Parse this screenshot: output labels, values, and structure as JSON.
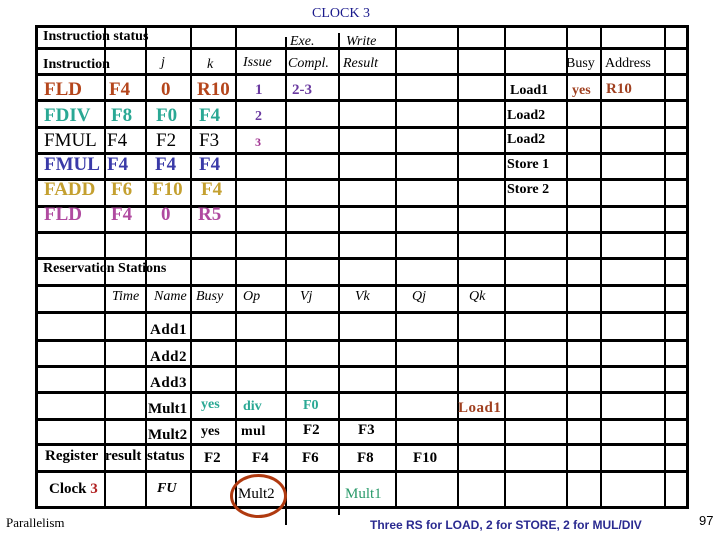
{
  "title": "CLOCK 3",
  "colors": {
    "title": "#1a1a8c",
    "fld1": "#b5461c",
    "fdiv": "#2aa894",
    "fmul1": "#000000",
    "fmul2": "#3a3aa8",
    "fadd": "#c4a030",
    "fld2": "#b04aa0",
    "issue": "#6a3aa0",
    "issue3": "#a03090",
    "load1": "#a04020",
    "mult1": "#2a9a6a",
    "clock_num": "#b02020",
    "highlight_circle": "#b03a10",
    "footer_note": "#2a2a90"
  },
  "instruction_status": {
    "section_label": "Instruction status",
    "headers": {
      "instruction": "Instruction",
      "j": "j",
      "k": "k",
      "issue": "Issue",
      "exe_top": "Exe.",
      "exe_bottom": "Compl.",
      "write_top": "Write",
      "write_bottom": "Result"
    },
    "rows": [
      {
        "op": "FLD",
        "dest": "F4",
        "j": "0",
        "k": "R10",
        "issue": "1",
        "exec": "2-3",
        "write": ""
      },
      {
        "op": "FDIV",
        "dest": "F8",
        "j": "F0",
        "k": "F4",
        "issue": "2",
        "exec": "",
        "write": ""
      },
      {
        "op": "FMUL",
        "dest": "F4",
        "j": "F2",
        "k": "F3",
        "issue": "3",
        "exec": "",
        "write": ""
      },
      {
        "op": "FMUL",
        "dest": "F4",
        "j": "F4",
        "k": "F4",
        "issue": "",
        "exec": "",
        "write": ""
      },
      {
        "op": "FADD",
        "dest": "F6",
        "j": "F10",
        "k": "F4",
        "issue": "",
        "exec": "",
        "write": ""
      },
      {
        "op": "FLD",
        "dest": "F4",
        "j": "0",
        "k": "R5",
        "issue": "",
        "exec": "",
        "write": ""
      }
    ]
  },
  "load_store_buffers": {
    "headers": {
      "busy": "Busy",
      "address": "Address"
    },
    "rows": [
      {
        "name": "Load1",
        "busy": "yes",
        "address": "R10"
      },
      {
        "name": "Load2",
        "busy": "",
        "address": ""
      },
      {
        "name": "Load2",
        "busy": "",
        "address": ""
      },
      {
        "name": "Store 1",
        "busy": "",
        "address": ""
      },
      {
        "name": "Store 2",
        "busy": "",
        "address": ""
      }
    ]
  },
  "reservation_stations": {
    "section_label": "Reservation Stations",
    "headers": {
      "time": "Time",
      "name": "Name",
      "busy": "Busy",
      "op": "Op",
      "vj": "Vj",
      "vk": "Vk",
      "qj": "Qj",
      "qk": "Qk"
    },
    "rows": [
      {
        "name": "Add1",
        "busy": "",
        "op": "",
        "vj": "",
        "vk": "",
        "qj": "",
        "qk": ""
      },
      {
        "name": "Add2",
        "busy": "",
        "op": "",
        "vj": "",
        "vk": "",
        "qj": "",
        "qk": ""
      },
      {
        "name": "Add3",
        "busy": "",
        "op": "",
        "vj": "",
        "vk": "",
        "qj": "",
        "qk": ""
      },
      {
        "name": "Mult1",
        "busy": "yes",
        "op": "div",
        "vj": "F0",
        "vk": "",
        "qj": "",
        "qk": "Load1"
      },
      {
        "name": "Mult2",
        "busy": "yes",
        "op": "mul",
        "vj": "F2",
        "vk": "F3",
        "qj": "",
        "qk": ""
      }
    ]
  },
  "register_result_status": {
    "label_parts": [
      "Register",
      "result",
      "status"
    ],
    "registers": [
      "F2",
      "F4",
      "F6",
      "F8",
      "F10"
    ],
    "clock_label": "Clock",
    "clock_value": "3",
    "fu_label": "FU",
    "fu": [
      "",
      "Mult2",
      "",
      "Mult1",
      ""
    ]
  },
  "footer": {
    "left": "Parallelism",
    "note": "Three  RS for LOAD, 2 for  STORE, 2 for MUL/DIV",
    "page_number": "97"
  }
}
